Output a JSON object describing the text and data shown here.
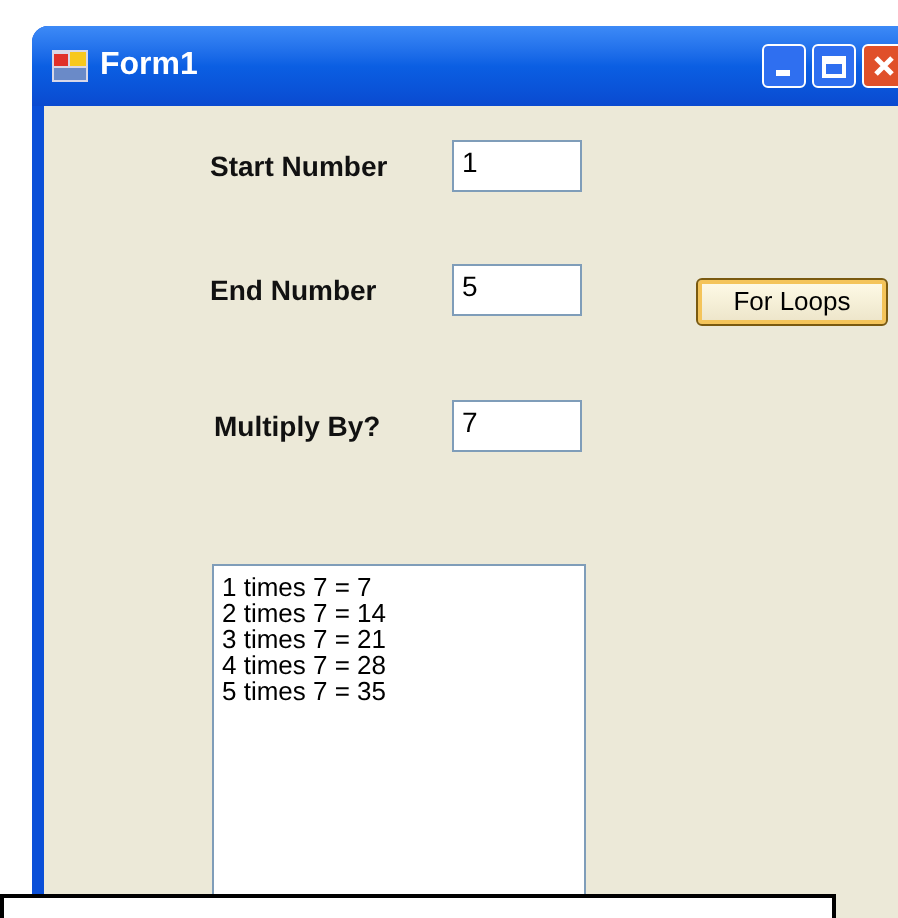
{
  "window": {
    "title": "Form1"
  },
  "fields": [
    {
      "label": "Start Number",
      "value": "1"
    },
    {
      "label": "End Number",
      "value": "5"
    },
    {
      "label": "Multiply By?",
      "value": "7"
    }
  ],
  "button": {
    "label": "For Loops"
  },
  "list_box": {
    "items": [
      "1 times 7 = 7",
      "2 times 7 = 14",
      "3 times 7 = 21",
      "4 times 7 = 28",
      "5 times 7 = 35"
    ]
  }
}
